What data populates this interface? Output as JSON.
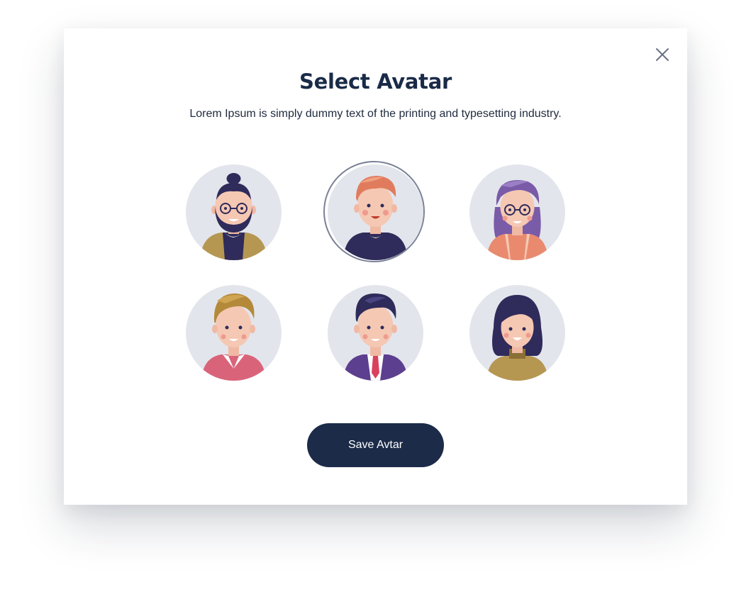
{
  "dialog": {
    "title": "Select Avatar",
    "subtitle": "Lorem Ipsum is simply dummy text of the printing and typesetting industry.",
    "close_icon": "close-icon",
    "save_label": "Save Avtar"
  },
  "avatars": [
    {
      "id": "avatar-1",
      "description": "bearded-man-glasses",
      "selected": false
    },
    {
      "id": "avatar-2",
      "description": "man-orange-hair",
      "selected": true
    },
    {
      "id": "avatar-3",
      "description": "woman-purple-hair-glasses",
      "selected": false
    },
    {
      "id": "avatar-4",
      "description": "boy-blonde-hair",
      "selected": false
    },
    {
      "id": "avatar-5",
      "description": "man-suit-tie",
      "selected": false
    },
    {
      "id": "avatar-6",
      "description": "woman-dark-hair",
      "selected": false
    }
  ],
  "colors": {
    "primary": "#1b2b48",
    "avatar_bg": "#e3e5ec",
    "selected_ring": "#7a8196"
  }
}
